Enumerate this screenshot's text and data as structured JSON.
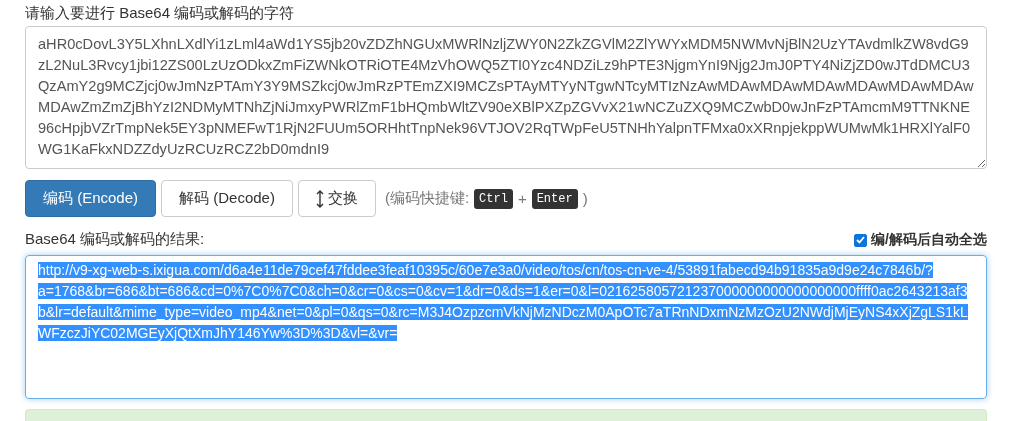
{
  "input": {
    "label": "请输入要进行 Base64 编码或解码的字符",
    "value": "aHR0cDovL3Y5LXhnLXdlYi1zLml4aWd1YS5jb20vZDZhNGUxMWRlNzljZWY0N2ZkZGVlM2ZlYWYxMDM5NWMvNjBlN2UzYTAvdmlkZW8vdG9zL2NuL3Rvcy1jbi12ZS00LzUzODkxZmFiZWNkOTRiOTE4MzVhOWQ5ZTI0Yzc4NDZiLz9hPTE3NjgmYnI9Njg2JmJ0PTY4NiZjZD0wJTdDMCU3QzAmY2g9MCZjcj0wJmNzPTAmY3Y9MSZkcj0wJmRzPTEmZXI9MCZsPTAyMTYyNTgwNTcyMTIzNzAwMDAwMDAwMDAwMDAwMDAwMDAwMDAwZmZmZjBhYzI2NDMyMTNhZjNiJmxyPWRlZmF1bHQmbWltZV90eXBlPXZpZGVvX21wNCZuZXQ9MCZwbD0wJnFzPTAmcmM9TTNKNE96cHpjbVZrTmpNek5EY3pNMEFwT1RjN2FUUm5ORHhtTnpNek96VTJOV2RqTWpFeU5TNHhYalpnTFMxa0xXRnpjekppWUMwMk1HRXlYalF0WG1KaFkxNDZZdyUzRCUzRCZ2bD0mdnI9"
  },
  "buttons": [
    {
      "kind": "primary",
      "label": "编码 (Encode)"
    },
    {
      "kind": "default",
      "label": "解码 (Decode)"
    },
    {
      "kind": "swap",
      "label": "交换"
    }
  ],
  "shortcut": {
    "prefix": "(编码快捷键:",
    "keys": [
      "Ctrl",
      "Enter"
    ],
    "joiner": "+",
    "suffix": ")"
  },
  "result": {
    "label": "Base64 编码或解码的结果:",
    "auto_select": {
      "label": "编/解码后自动全选",
      "checked": true
    },
    "value": "http://v9-xg-web-s.ixigua.com/d6a4e11de79cef47fddee3feaf10395c/60e7e3a0/video/tos/cn/tos-cn-ve-4/53891fabecd94b91835a9d9e24c7846b/?a=1768&br=686&bt=686&cd=0%7C0%7C0&ch=0&cr=0&cs=0&cv=1&dr=0&ds=1&er=0&l=021625805721237000000000000000000ffff0ac2643213af3b&lr=default&mime_type=video_mp4&net=0&pl=0&qs=0&rc=M3J4OzpzcmVkNjMzNDczM0ApOTc7aTRnNDxmNzMzOzU2NWdjMjEyNS4xXjZgLS1kLWFzczJiYC02MGEyXjQtXmJhY146Yw%3D%3D&vl=&vr=",
    "selected": true
  }
}
